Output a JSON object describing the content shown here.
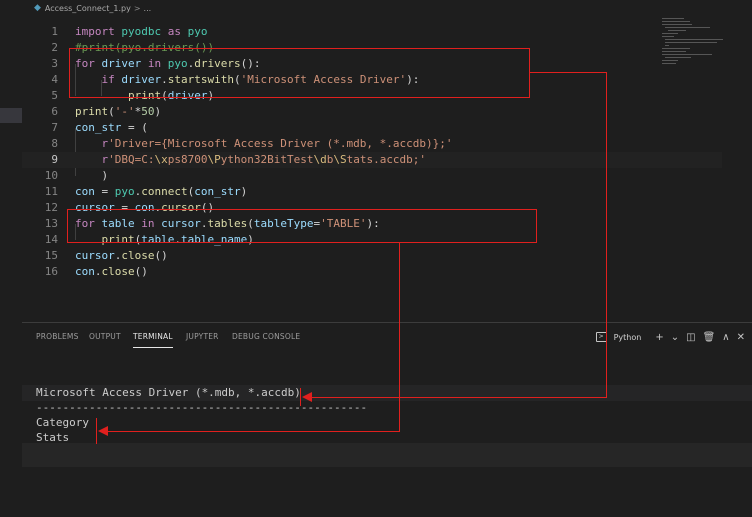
{
  "tab": {
    "filename": "Access_Connect_1.py",
    "sep": ">",
    "crumb": "..."
  },
  "editor": {
    "lines": [
      {
        "n": "1",
        "tokens": [
          [
            "kw",
            "import"
          ],
          [
            "op",
            " "
          ],
          [
            "mod",
            "pyodbc"
          ],
          [
            "op",
            " "
          ],
          [
            "kw",
            "as"
          ],
          [
            "op",
            " "
          ],
          [
            "mod",
            "pyo"
          ]
        ]
      },
      {
        "n": "2",
        "tokens": [
          [
            "cm",
            "#print(pyo.drivers())"
          ]
        ]
      },
      {
        "n": "3",
        "tokens": [
          [
            "kw",
            "for"
          ],
          [
            "op",
            " "
          ],
          [
            "vr",
            "driver"
          ],
          [
            "op",
            " "
          ],
          [
            "kw",
            "in"
          ],
          [
            "op",
            " "
          ],
          [
            "mod",
            "pyo"
          ],
          [
            "op",
            "."
          ],
          [
            "fn",
            "drivers"
          ],
          [
            "op",
            "():"
          ]
        ]
      },
      {
        "n": "4",
        "tokens": [
          [
            "op",
            "    "
          ],
          [
            "kw",
            "if"
          ],
          [
            "op",
            " "
          ],
          [
            "vr",
            "driver"
          ],
          [
            "op",
            "."
          ],
          [
            "fn",
            "startswith"
          ],
          [
            "op",
            "("
          ],
          [
            "st",
            "'Microsoft Access Driver'"
          ],
          [
            "op",
            "):"
          ]
        ]
      },
      {
        "n": "5",
        "tokens": [
          [
            "op",
            "        "
          ],
          [
            "fn",
            "print"
          ],
          [
            "op",
            "("
          ],
          [
            "vr",
            "driver"
          ],
          [
            "op",
            ")"
          ]
        ]
      },
      {
        "n": "6",
        "tokens": [
          [
            "fn",
            "print"
          ],
          [
            "op",
            "("
          ],
          [
            "st",
            "'-'"
          ],
          [
            "op",
            "*"
          ],
          [
            "nm",
            "50"
          ],
          [
            "op",
            ")"
          ]
        ]
      },
      {
        "n": "7",
        "tokens": [
          [
            "vr",
            "con_str"
          ],
          [
            "op",
            " = ("
          ]
        ]
      },
      {
        "n": "8",
        "tokens": [
          [
            "op",
            "    "
          ],
          [
            "kw",
            "r"
          ],
          [
            "st",
            "'Driver={Microsoft Access Driver (*.mdb, *.accdb)};'"
          ]
        ]
      },
      {
        "n": "9",
        "tokens": [
          [
            "op",
            "    "
          ],
          [
            "kw",
            "r"
          ],
          [
            "st",
            "'DBQ=C:"
          ],
          [
            "esc",
            "\\x"
          ],
          [
            "st",
            "ps8700"
          ],
          [
            "esc",
            "\\P"
          ],
          [
            "st",
            "ython32BitTest"
          ],
          [
            "esc",
            "\\d"
          ],
          [
            "st",
            "b"
          ],
          [
            "esc",
            "\\S"
          ],
          [
            "st",
            "tats.accdb;'"
          ]
        ]
      },
      {
        "n": "10",
        "tokens": [
          [
            "op",
            "    )"
          ]
        ]
      },
      {
        "n": "11",
        "tokens": [
          [
            "vr",
            "con"
          ],
          [
            "op",
            " = "
          ],
          [
            "mod",
            "pyo"
          ],
          [
            "op",
            "."
          ],
          [
            "fn",
            "connect"
          ],
          [
            "op",
            "("
          ],
          [
            "vr",
            "con_str"
          ],
          [
            "op",
            ")"
          ]
        ]
      },
      {
        "n": "12",
        "tokens": [
          [
            "vr",
            "cursor"
          ],
          [
            "op",
            " = "
          ],
          [
            "vr",
            "con"
          ],
          [
            "op",
            "."
          ],
          [
            "fn",
            "cursor"
          ],
          [
            "op",
            "()"
          ]
        ]
      },
      {
        "n": "13",
        "tokens": [
          [
            "kw",
            "for"
          ],
          [
            "op",
            " "
          ],
          [
            "vr",
            "table"
          ],
          [
            "op",
            " "
          ],
          [
            "kw",
            "in"
          ],
          [
            "op",
            " "
          ],
          [
            "vr",
            "cursor"
          ],
          [
            "op",
            "."
          ],
          [
            "fn",
            "tables"
          ],
          [
            "op",
            "("
          ],
          [
            "vr",
            "tableType"
          ],
          [
            "op",
            "="
          ],
          [
            "st",
            "'TABLE'"
          ],
          [
            "op",
            "):"
          ]
        ]
      },
      {
        "n": "14",
        "tokens": [
          [
            "op",
            "    "
          ],
          [
            "fn",
            "print"
          ],
          [
            "op",
            "("
          ],
          [
            "vr",
            "table"
          ],
          [
            "op",
            "."
          ],
          [
            "vr",
            "table_name"
          ],
          [
            "op",
            ")"
          ]
        ]
      },
      {
        "n": "15",
        "tokens": [
          [
            "vr",
            "cursor"
          ],
          [
            "op",
            "."
          ],
          [
            "fn",
            "close"
          ],
          [
            "op",
            "()"
          ]
        ]
      },
      {
        "n": "16",
        "tokens": [
          [
            "vr",
            "con"
          ],
          [
            "op",
            "."
          ],
          [
            "fn",
            "close"
          ],
          [
            "op",
            "()"
          ]
        ]
      }
    ]
  },
  "panel": {
    "tabs": [
      "PROBLEMS",
      "OUTPUT",
      "TERMINAL",
      "JUPYTER",
      "DEBUG CONSOLE"
    ],
    "active_tab": "TERMINAL",
    "terminal_profile": "Python",
    "terminal_icon": ">",
    "actions": {
      "add": "+",
      "dropdown": "⌄",
      "split": "◫",
      "trash": "🗑",
      "maximize": "∧",
      "close": "✕"
    }
  },
  "terminal": {
    "lines": [
      "Microsoft Access Driver (*.mdb, *.accdb)",
      "--------------------------------------------------",
      "Category",
      "Stats"
    ]
  },
  "colors": {
    "annotation": "#e0201e",
    "background": "#1e1e1e"
  }
}
